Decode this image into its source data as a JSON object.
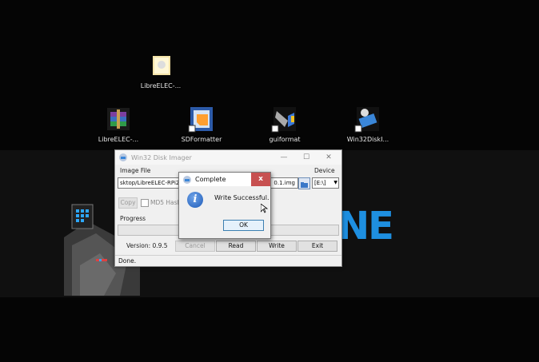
{
  "desktop": {
    "icons": [
      {
        "label": "LibreELEC-...",
        "icon": "folder-icon"
      },
      {
        "label": "LibreELEC-...",
        "icon": "winrar-archive-icon"
      },
      {
        "label": "SDFormatter",
        "icon": "sdformatter-icon"
      },
      {
        "label": "guiformat",
        "icon": "guiformat-icon"
      },
      {
        "label": "Win32DiskI...",
        "icon": "win32diskimager-icon"
      }
    ],
    "wallpaper_text": "NE"
  },
  "main_window": {
    "title": "Win32 Disk Imager",
    "image_file_label": "Image File",
    "image_path": "sktop/LibreELEC-RPi2.a",
    "image_path_end": "0.1.img",
    "device_label": "Device",
    "device_value": "[E:\\]",
    "copy_label": "Copy",
    "md5_label": "MD5 Hash:",
    "progress_label": "Progress",
    "progress": 1.0,
    "version": "Version: 0.9.5",
    "buttons": {
      "cancel": "Cancel",
      "read": "Read",
      "write": "Write",
      "exit": "Exit"
    },
    "status": "Done."
  },
  "dialog": {
    "title": "Complete",
    "message": "Write Successful.",
    "ok_label": "OK"
  }
}
